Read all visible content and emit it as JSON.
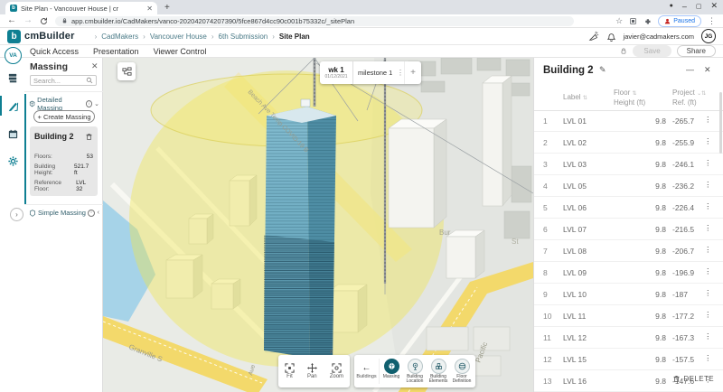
{
  "browser": {
    "tab_title": "Site Plan - Vancouver House | cr",
    "url": "app.cmbuilder.io/CadMakers/vanco-202042074207390/5fce867d4cc90c001b75332c/_sitePlan",
    "paused_label": "Paused"
  },
  "header": {
    "logo_text": "cmBuilder",
    "breadcrumb": [
      "CadMakers",
      "Vancouver House",
      "6th Submission",
      "Site Plan"
    ],
    "user_email": "javier@cadmakers.com",
    "avatar_initials": "JG",
    "workspace_initials": "VA"
  },
  "menubar": {
    "items": [
      "Quick Access",
      "Presentation",
      "Viewer Control"
    ],
    "save_label": "Save",
    "share_label": "Share"
  },
  "massing_panel": {
    "title": "Massing",
    "search_placeholder": "Search...",
    "detailed_section": "Detailed Massing",
    "create_button": "+ Create Massing",
    "card": {
      "title": "Building 2",
      "fields": [
        {
          "label": "Floors:",
          "value": "53"
        },
        {
          "label": "Building Height:",
          "value": "521.7 ft"
        },
        {
          "label": "Reference Floor:",
          "value": "LVL 32"
        }
      ]
    },
    "simple_section": "Simple Massing"
  },
  "viewport": {
    "timeline": {
      "week": "wk 1",
      "date": "01/12/2021",
      "milestone": "milestone 1"
    },
    "nav_tools": [
      {
        "label": "Fit"
      },
      {
        "label": "Pan"
      },
      {
        "label": "Zoom"
      }
    ],
    "back_label": "Buildings",
    "mode_tools": [
      "Massing",
      "Building Location",
      "Building Elements",
      "Floor Definition"
    ],
    "streets": {
      "granville": "Granville S",
      "pacific": "Pacific",
      "beach": "Beach Ave Temp COVID-19 B",
      "bur": "Bur",
      "st": "St",
      "ave": "Ave"
    },
    "accent_yellow": "#f0e64b",
    "tower_teal": "#4f8ea5"
  },
  "levels_panel": {
    "title": "Building 2",
    "col_label": "Label",
    "col_height_1": "Floor",
    "col_height_2": "Height (ft)",
    "col_ref_1": "Project",
    "col_ref_2": "Ref. (ft)",
    "rows": [
      {
        "num": "1",
        "label": "LVL 01",
        "height": "9.8",
        "ref": "-265.7"
      },
      {
        "num": "2",
        "label": "LVL 02",
        "height": "9.8",
        "ref": "-255.9"
      },
      {
        "num": "3",
        "label": "LVL 03",
        "height": "9.8",
        "ref": "-246.1"
      },
      {
        "num": "4",
        "label": "LVL 05",
        "height": "9.8",
        "ref": "-236.2"
      },
      {
        "num": "5",
        "label": "LVL 06",
        "height": "9.8",
        "ref": "-226.4"
      },
      {
        "num": "6",
        "label": "LVL 07",
        "height": "9.8",
        "ref": "-216.5"
      },
      {
        "num": "7",
        "label": "LVL 08",
        "height": "9.8",
        "ref": "-206.7"
      },
      {
        "num": "8",
        "label": "LVL 09",
        "height": "9.8",
        "ref": "-196.9"
      },
      {
        "num": "9",
        "label": "LVL 10",
        "height": "9.8",
        "ref": "-187"
      },
      {
        "num": "10",
        "label": "LVL 11",
        "height": "9.8",
        "ref": "-177.2"
      },
      {
        "num": "11",
        "label": "LVL 12",
        "height": "9.8",
        "ref": "-167.3"
      },
      {
        "num": "12",
        "label": "LVL 15",
        "height": "9.8",
        "ref": "-157.5"
      },
      {
        "num": "13",
        "label": "LVL 16",
        "height": "9.8",
        "ref": "-147.6"
      }
    ],
    "delete_label": "DELETE"
  },
  "brand_color": "#0e7f92"
}
